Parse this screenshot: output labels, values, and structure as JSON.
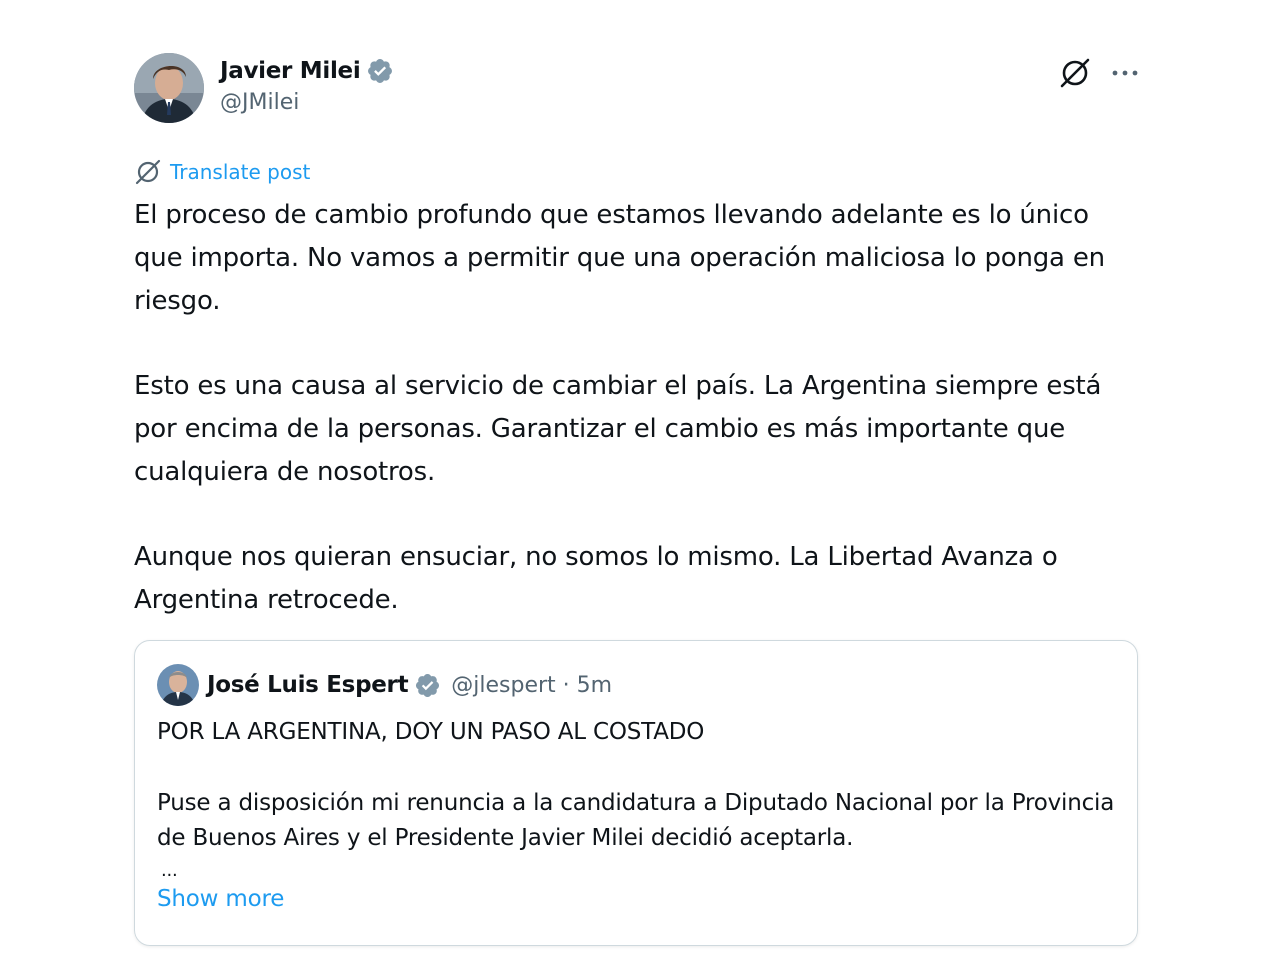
{
  "post": {
    "author": {
      "name": "Javier Milei",
      "handle": "@JMilei",
      "verified": true
    },
    "translate_label": "Translate post",
    "paragraphs": [
      "El proceso de cambio profundo que estamos llevando adelante es lo único que importa. No vamos a permitir que una operación maliciosa lo ponga en riesgo.",
      "Esto es una causa al servicio de cambiar el país. La Argentina siempre está por encima de la personas. Garantizar el cambio es más importante que cualquiera de nosotros.",
      "Aunque nos quieran ensuciar, no somos lo mismo. La Libertad Avanza o Argentina retrocede."
    ]
  },
  "quote": {
    "author": {
      "name": "José Luis Espert",
      "handle": "@jlespert",
      "time": "5m",
      "verified": true
    },
    "meta_line": "@jlespert · 5m",
    "title": "POR LA ARGENTINA, DOY UN PASO AL COSTADO",
    "body": "Puse a disposición mi renuncia a la candidatura a Diputado Nacional por la Provincia de Buenos Aires y el Presidente Javier Milei decidió aceptarla.",
    "ellipsis": "...",
    "show_more_label": "Show more"
  },
  "icons": {
    "grok": "grok-icon",
    "more": "more-options-icon",
    "verified": "verified-badge-icon",
    "translate": "translate-icon"
  },
  "colors": {
    "link": "#1d9bf0",
    "verified": "#829aab",
    "secondary_text": "#536471",
    "border": "#cfd9de"
  }
}
